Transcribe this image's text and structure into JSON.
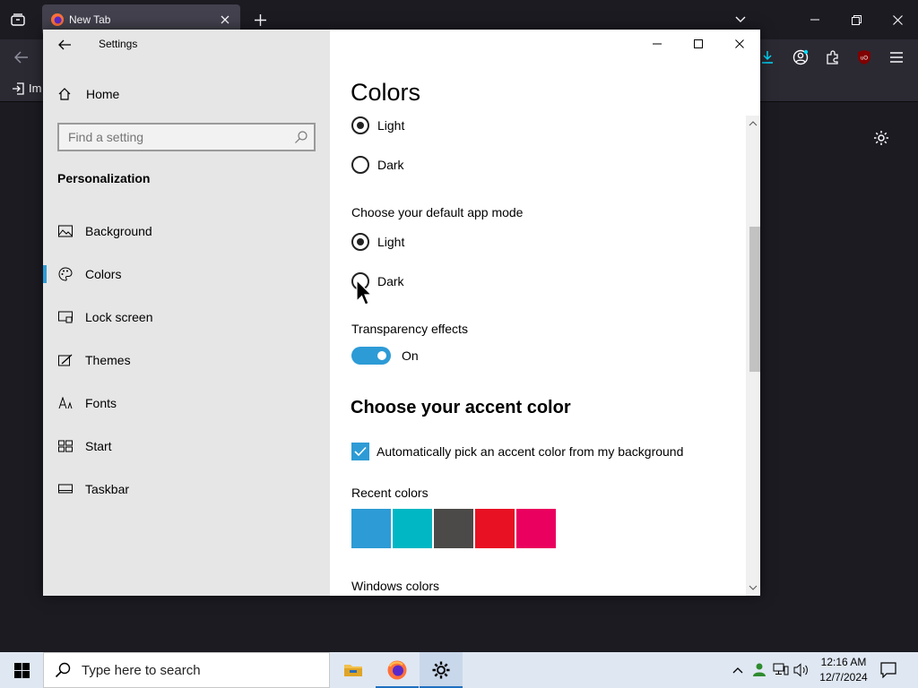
{
  "browser": {
    "tab_title": "New Tab",
    "bookmark_label": "Im"
  },
  "window": {
    "title": "Settings"
  },
  "sidebar": {
    "home_label": "Home",
    "search_placeholder": "Find a setting",
    "section_title": "Personalization",
    "items": [
      {
        "label": "Background",
        "icon": "picture-icon"
      },
      {
        "label": "Colors",
        "icon": "palette-icon",
        "selected": true
      },
      {
        "label": "Lock screen",
        "icon": "lock-screen-icon"
      },
      {
        "label": "Themes",
        "icon": "themes-icon"
      },
      {
        "label": "Fonts",
        "icon": "fonts-icon"
      },
      {
        "label": "Start",
        "icon": "start-icon"
      },
      {
        "label": "Taskbar",
        "icon": "taskbar-icon"
      }
    ]
  },
  "content": {
    "title": "Colors",
    "windows_mode": {
      "options": [
        {
          "label": "Light",
          "checked": true
        },
        {
          "label": "Dark",
          "checked": false
        }
      ]
    },
    "app_mode": {
      "label": "Choose your default app mode",
      "options": [
        {
          "label": "Light",
          "checked": true
        },
        {
          "label": "Dark",
          "checked": false
        }
      ]
    },
    "transparency": {
      "label": "Transparency effects",
      "state": "On",
      "enabled": true
    },
    "accent": {
      "heading": "Choose your accent color",
      "auto_pick_label": "Automatically pick an accent color from my background",
      "auto_pick_checked": true,
      "recent_label": "Recent colors",
      "recent_colors": [
        "#2d9bd6",
        "#00b7c3",
        "#4c4a48",
        "#e81123",
        "#ea005e"
      ],
      "windows_colors_label": "Windows colors"
    }
  },
  "taskbar": {
    "search_placeholder": "Type here to search",
    "apps": [
      {
        "name": "File Explorer",
        "icon": "folder-icon"
      },
      {
        "name": "Firefox",
        "icon": "firefox-icon"
      },
      {
        "name": "Settings",
        "icon": "gear-icon",
        "active": true
      }
    ],
    "time": "12:16 AM",
    "date": "12/7/2024"
  },
  "colors": {
    "accent": "#2d9bd6",
    "sidebar_bg": "#e6e6e6",
    "taskbar_bg": "#dfe7f2",
    "browser_bg": "#1c1b22"
  }
}
